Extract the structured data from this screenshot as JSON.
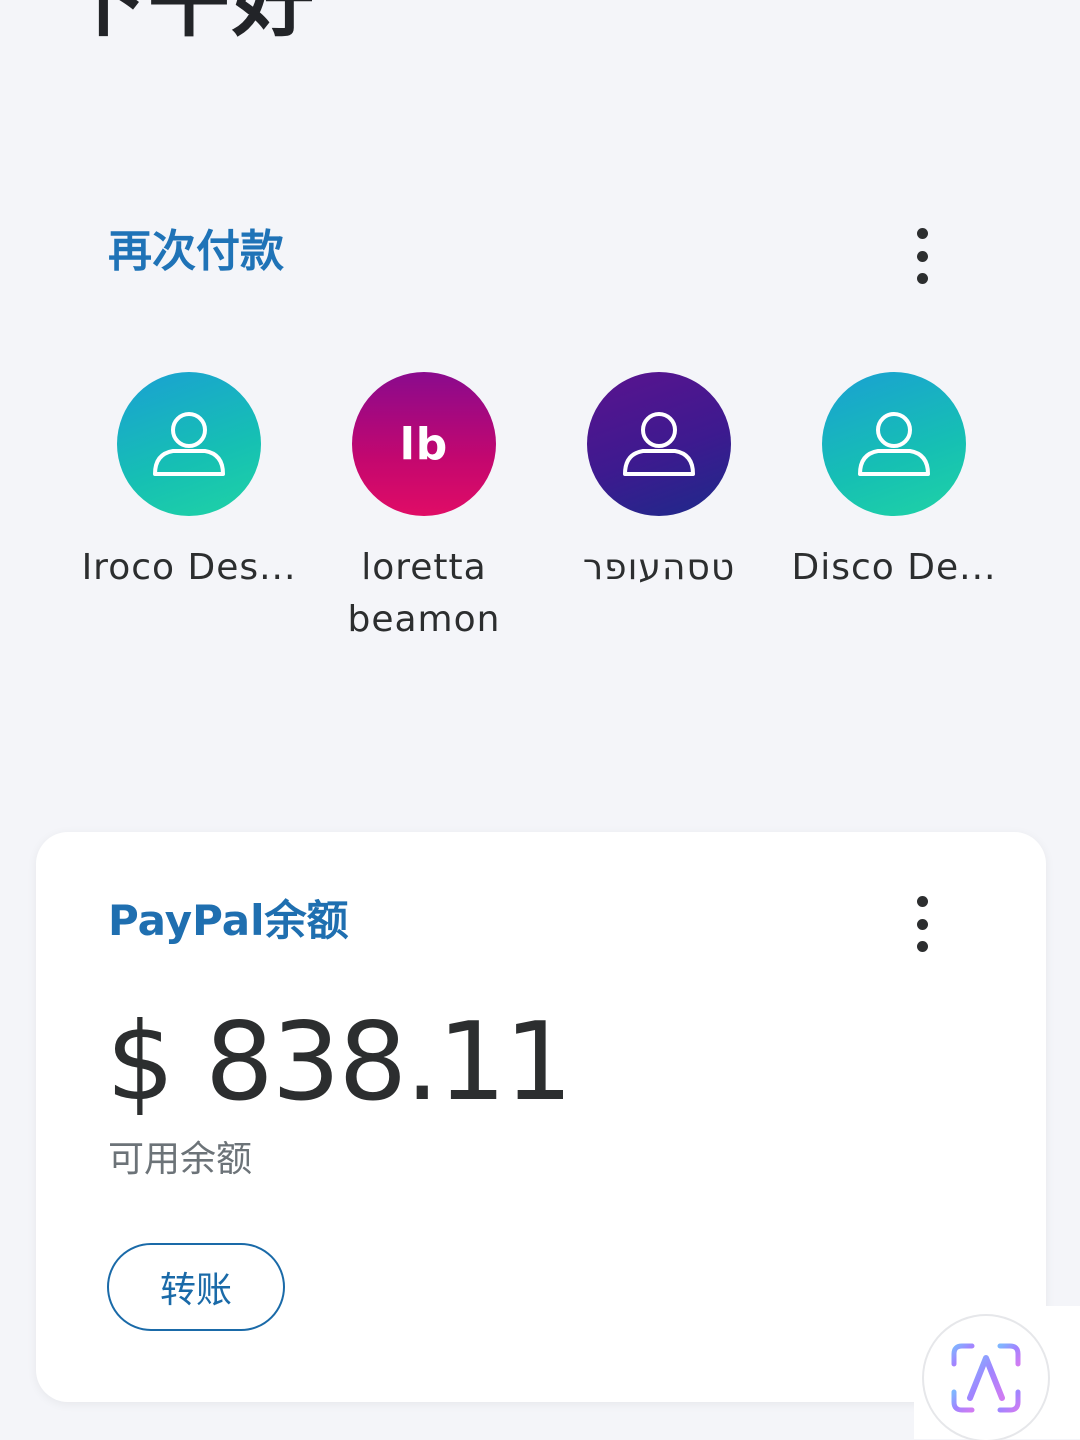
{
  "greeting": "下午好",
  "pay_again": {
    "title": "再次付款",
    "more_icon": "more-vertical-icon",
    "contacts": [
      {
        "name": "Iroco Des...",
        "avatar": "person-icon",
        "avatar_style": "teal"
      },
      {
        "name": "loretta\nbeamon",
        "initials": "lb",
        "avatar_style": "magenta"
      },
      {
        "name": "טסהעופר",
        "avatar": "person-icon",
        "avatar_style": "indigo"
      },
      {
        "name": "Disco De...",
        "avatar": "person-icon",
        "avatar_style": "teal"
      }
    ]
  },
  "balance_card": {
    "title": "PayPal余额",
    "amount": "$ 838.11",
    "amount_label": "可用余额",
    "transfer_button": "转账",
    "more_icon": "more-vertical-icon"
  },
  "floating_button": {
    "icon": "text-recognition-icon"
  },
  "colors": {
    "accent_blue": "#1f73b7",
    "background": "#f4f5f9",
    "card_background": "#ffffff"
  }
}
